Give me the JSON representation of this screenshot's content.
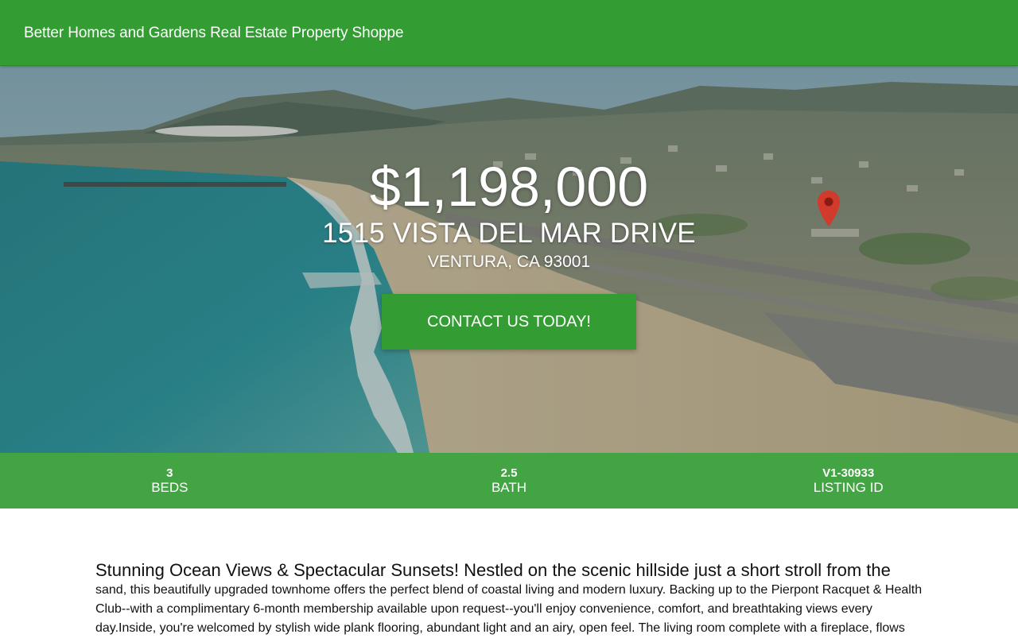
{
  "header": {
    "brand": "Better Homes and Gardens Real Estate Property Shoppe"
  },
  "hero": {
    "price": "$1,198,000",
    "address": "1515 VISTA DEL MAR DRIVE",
    "city_line": "VENTURA, CA 93001",
    "cta_label": "CONTACT US TODAY!",
    "image_subject": "aerial coastal view of Ventura beach, pier and hillside homes with red location pin"
  },
  "stats": {
    "beds": {
      "value": "3",
      "label": "BEDS"
    },
    "bath": {
      "value": "2.5",
      "label": "BATH"
    },
    "listing": {
      "value": "V1-30933",
      "label": "LISTING ID"
    }
  },
  "description": {
    "lead": "Stunning Ocean Views & Spectacular Sunsets! Nestled on the scenic hillside just a short stroll from the",
    "body": "sand, this beautifully upgraded townhome offers the perfect blend of coastal living and modern luxury. Backing up to the Pierpont Racquet & Health Club--with a complimentary 6-month membership available upon request--you'll enjoy convenience, comfort, and breathtaking views every day.Inside, you're welcomed by stylish wide plank flooring, abundant light and an airy, open feel. The living room complete with a fireplace, flows"
  },
  "colors": {
    "brand_green": "#339c33",
    "pin_red": "#d23a2c"
  },
  "icons": {
    "map_pin": "location-pin-icon"
  }
}
